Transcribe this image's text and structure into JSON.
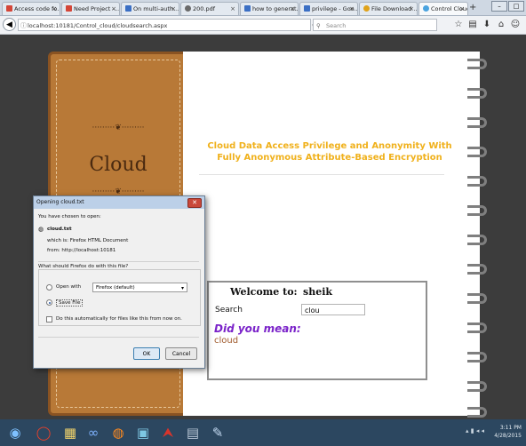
{
  "browser": {
    "tabs": [
      {
        "label": "Access code fo...",
        "icon": "gmail-icon",
        "active": false
      },
      {
        "label": "Need Project -...",
        "icon": "gmail-icon",
        "active": false
      },
      {
        "label": "On multi-auth...",
        "icon": "bookmark-icon",
        "active": false
      },
      {
        "label": "200.pdf",
        "icon": "globe-icon",
        "active": false
      },
      {
        "label": "how to generat...",
        "icon": "bookmark-icon",
        "active": false
      },
      {
        "label": "privilege - Goo...",
        "icon": "bookmark-icon",
        "active": false
      },
      {
        "label": "File Download ...",
        "icon": "download-icon",
        "active": false
      },
      {
        "label": "Control Cloud ...",
        "icon": "cloud-icon",
        "active": true
      }
    ],
    "new_tab": "+",
    "url": "localhost:10181/Control_cloud/cloudsearch.aspx",
    "search_placeholder": "Search"
  },
  "page": {
    "brand": "Cloud",
    "heading": "Cloud Data Access Privilege and Anonymity With Fully Anonymous Attribute-Based Encryption",
    "welcome_label": "Welcome to:",
    "welcome_name": "sheik",
    "search_label": "Search",
    "search_value": "clou",
    "did_you_mean": "Did you mean:",
    "suggestion": "cloud"
  },
  "dialog": {
    "title": "Opening cloud.txt",
    "intro": "You have chosen to open:",
    "file_name": "cloud.txt",
    "which_is": "which is: Firefox HTML Document",
    "from": "from: http://localhost:10181",
    "question": "What should Firefox do with this file?",
    "open_with_label": "Open with",
    "open_with_value": "Firefox (default)",
    "save_file_label": "Save File",
    "auto_label": "Do this automatically for files like this from now on.",
    "ok_label": "OK",
    "cancel_label": "Cancel"
  },
  "taskbar": {
    "time": "3:11 PM",
    "date": "4/28/2015"
  }
}
